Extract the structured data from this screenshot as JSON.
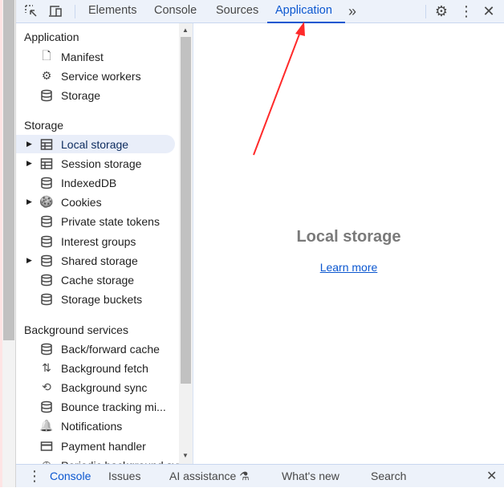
{
  "toolbar": {
    "tabs": [
      "Elements",
      "Console",
      "Sources",
      "Application"
    ],
    "active_tab": "Application",
    "more_icon": "»"
  },
  "sidebar": {
    "sections": [
      {
        "title": "Application",
        "items": [
          {
            "label": "Manifest",
            "icon": "file-icon"
          },
          {
            "label": "Service workers",
            "icon": "gears-icon"
          },
          {
            "label": "Storage",
            "icon": "database-icon"
          }
        ]
      },
      {
        "title": "Storage",
        "items": [
          {
            "label": "Local storage",
            "icon": "table-icon",
            "expandable": true,
            "selected": true
          },
          {
            "label": "Session storage",
            "icon": "table-icon",
            "expandable": true
          },
          {
            "label": "IndexedDB",
            "icon": "database-icon"
          },
          {
            "label": "Cookies",
            "icon": "cookie-icon",
            "expandable": true
          },
          {
            "label": "Private state tokens",
            "icon": "database-icon"
          },
          {
            "label": "Interest groups",
            "icon": "database-icon"
          },
          {
            "label": "Shared storage",
            "icon": "database-icon",
            "expandable": true
          },
          {
            "label": "Cache storage",
            "icon": "database-icon"
          },
          {
            "label": "Storage buckets",
            "icon": "database-icon"
          }
        ]
      },
      {
        "title": "Background services",
        "items": [
          {
            "label": "Back/forward cache",
            "icon": "database-icon"
          },
          {
            "label": "Background fetch",
            "icon": "arrows-updown-icon"
          },
          {
            "label": "Background sync",
            "icon": "sync-icon"
          },
          {
            "label": "Bounce tracking mi...",
            "icon": "database-icon"
          },
          {
            "label": "Notifications",
            "icon": "bell-icon"
          },
          {
            "label": "Payment handler",
            "icon": "card-icon"
          },
          {
            "label": "Periodic background sync",
            "icon": "clock-icon"
          }
        ]
      }
    ]
  },
  "main": {
    "title": "Local storage",
    "link": "Learn more"
  },
  "drawer": {
    "tabs": [
      "Console",
      "Issues",
      "AI assistance",
      "What's new",
      "Search"
    ],
    "active_tab": "Console"
  },
  "colors": {
    "accent": "#0b57d0",
    "annotation_arrow": "#ff2a2a",
    "toolbar_bg": "#edf2fa"
  }
}
